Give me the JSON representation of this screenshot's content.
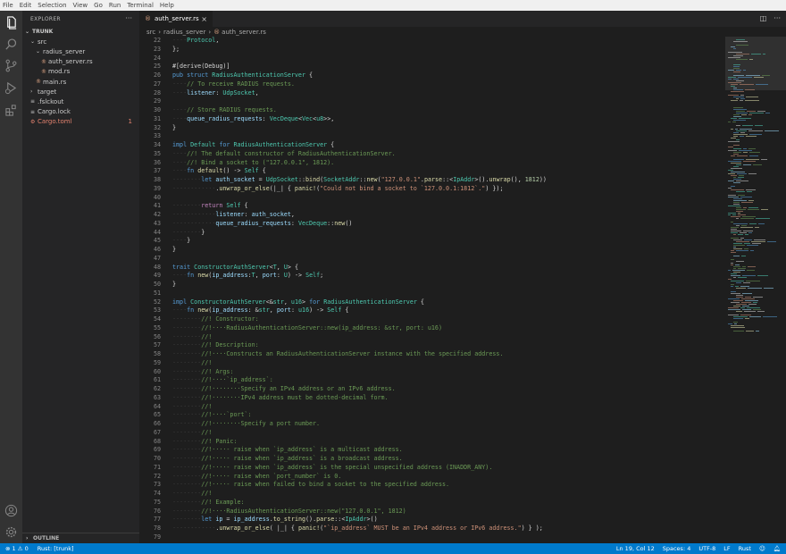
{
  "menu": [
    "File",
    "Edit",
    "Selection",
    "View",
    "Go",
    "Run",
    "Terminal",
    "Help"
  ],
  "activity_bar": [
    "files-icon",
    "search-icon",
    "source-control-icon",
    "run-debug-icon",
    "extensions-icon",
    "account-icon",
    "settings-gear-icon"
  ],
  "sidebar": {
    "title": "EXPLORER",
    "more": "···",
    "root": "TRUNK",
    "items": [
      {
        "label": "src",
        "depth": 1,
        "kind": "folder-open"
      },
      {
        "label": "radius_server",
        "depth": 2,
        "kind": "folder-open"
      },
      {
        "label": "auth_server.rs",
        "depth": 3,
        "kind": "rust"
      },
      {
        "label": "mod.rs",
        "depth": 3,
        "kind": "rust"
      },
      {
        "label": "main.rs",
        "depth": 2,
        "kind": "rust"
      },
      {
        "label": "target",
        "depth": 1,
        "kind": "folder"
      },
      {
        "label": ".fslckout",
        "depth": 1,
        "kind": "file"
      },
      {
        "label": "Cargo.lock",
        "depth": 1,
        "kind": "file"
      },
      {
        "label": "Cargo.toml",
        "depth": 1,
        "kind": "toml",
        "badge": "1"
      }
    ],
    "outline": "OUTLINE"
  },
  "tab": {
    "label": "auth_server.rs",
    "close": "×"
  },
  "breadcrumb": [
    "src",
    "radius_server",
    "auth_server.rs"
  ],
  "code_lines": [
    {
      "n": "22",
      "t": [
        [
          "ws",
          "····"
        ],
        [
          "ty",
          "Protocol"
        ],
        [
          "pl",
          ","
        ]
      ]
    },
    {
      "n": "23",
      "t": [
        [
          "pl",
          "};"
        ]
      ]
    },
    {
      "n": "24",
      "t": []
    },
    {
      "n": "25",
      "t": [
        [
          "at",
          "#[derive(Debug)]"
        ]
      ]
    },
    {
      "n": "26",
      "t": [
        [
          "kw",
          "pub struct "
        ],
        [
          "ty",
          "RadiusAuthenticationServer"
        ],
        [
          "pl",
          " {"
        ]
      ]
    },
    {
      "n": "27",
      "t": [
        [
          "ws",
          "····"
        ],
        [
          "cm",
          "// To receive RADIUS requests."
        ]
      ]
    },
    {
      "n": "28",
      "t": [
        [
          "ws",
          "····"
        ],
        [
          "var",
          "listener"
        ],
        [
          "pl",
          ": "
        ],
        [
          "ty",
          "UdpSocket"
        ],
        [
          "pl",
          ","
        ]
      ]
    },
    {
      "n": "29",
      "t": []
    },
    {
      "n": "30",
      "t": [
        [
          "ws",
          "····"
        ],
        [
          "cm",
          "// Store RADIUS requests."
        ]
      ]
    },
    {
      "n": "31",
      "t": [
        [
          "ws",
          "····"
        ],
        [
          "var",
          "queue_radius_requests"
        ],
        [
          "pl",
          ": "
        ],
        [
          "ty",
          "VecDeque"
        ],
        [
          "pl",
          "<"
        ],
        [
          "ty",
          "Vec"
        ],
        [
          "pl",
          "<"
        ],
        [
          "ty",
          "u8"
        ],
        [
          "pl",
          ">>,"
        ]
      ]
    },
    {
      "n": "32",
      "t": [
        [
          "pl",
          "}"
        ]
      ]
    },
    {
      "n": "33",
      "t": []
    },
    {
      "n": "34",
      "t": [
        [
          "kw",
          "impl "
        ],
        [
          "ty",
          "Default"
        ],
        [
          "kw",
          " for "
        ],
        [
          "ty",
          "RadiusAuthenticationServer"
        ],
        [
          "pl",
          " {"
        ]
      ]
    },
    {
      "n": "35",
      "t": [
        [
          "ws",
          "····"
        ],
        [
          "cm",
          "//! The default constructor of RadiusAuthenticationServer."
        ]
      ]
    },
    {
      "n": "36",
      "t": [
        [
          "ws",
          "····"
        ],
        [
          "cm",
          "//! Bind a socket to (\"127.0.0.1\", 1812)."
        ]
      ]
    },
    {
      "n": "37",
      "t": [
        [
          "ws",
          "····"
        ],
        [
          "kw",
          "fn "
        ],
        [
          "fn",
          "default"
        ],
        [
          "pl",
          "() -> "
        ],
        [
          "ty",
          "Self"
        ],
        [
          "pl",
          " {"
        ]
      ]
    },
    {
      "n": "38",
      "t": [
        [
          "ws",
          "········"
        ],
        [
          "kw",
          "let "
        ],
        [
          "var",
          "auth_socket"
        ],
        [
          "pl",
          " = "
        ],
        [
          "ty",
          "UdpSocket"
        ],
        [
          "pl",
          "::"
        ],
        [
          "fn",
          "bind"
        ],
        [
          "pl",
          "("
        ],
        [
          "ty",
          "SocketAddr"
        ],
        [
          "pl",
          "::"
        ],
        [
          "fn",
          "new"
        ],
        [
          "pl",
          "("
        ],
        [
          "str",
          "\"127.0.0.1\""
        ],
        [
          "pl",
          "."
        ],
        [
          "fn",
          "parse"
        ],
        [
          "pl",
          "::<"
        ],
        [
          "ty",
          "IpAddr"
        ],
        [
          "pl",
          ">()."
        ],
        [
          "fn",
          "unwrap"
        ],
        [
          "pl",
          "(), "
        ],
        [
          "num",
          "1812"
        ],
        [
          "pl",
          "))"
        ]
      ]
    },
    {
      "n": "39",
      "t": [
        [
          "ws",
          "············"
        ],
        [
          "pl",
          "."
        ],
        [
          "fn",
          "unwrap_or_else"
        ],
        [
          "pl",
          "(|_| { "
        ],
        [
          "fn",
          "panic!"
        ],
        [
          "pl",
          "("
        ],
        [
          "str",
          "\"Could not bind a socket to `127.0.0.1:1812`.\""
        ],
        [
          "pl",
          ") });"
        ]
      ]
    },
    {
      "n": "40",
      "t": []
    },
    {
      "n": "41",
      "t": [
        [
          "ws",
          "········"
        ],
        [
          "kw2",
          "return "
        ],
        [
          "ty",
          "Self"
        ],
        [
          "pl",
          " {"
        ]
      ]
    },
    {
      "n": "42",
      "t": [
        [
          "ws",
          "············"
        ],
        [
          "var",
          "listener"
        ],
        [
          "pl",
          ": "
        ],
        [
          "var",
          "auth_socket"
        ],
        [
          "pl",
          ","
        ]
      ]
    },
    {
      "n": "43",
      "t": [
        [
          "ws",
          "············"
        ],
        [
          "var",
          "queue_radius_requests"
        ],
        [
          "pl",
          ": "
        ],
        [
          "ty",
          "VecDeque"
        ],
        [
          "pl",
          "::"
        ],
        [
          "fn",
          "new"
        ],
        [
          "pl",
          "()"
        ]
      ]
    },
    {
      "n": "44",
      "t": [
        [
          "ws",
          "········"
        ],
        [
          "pl",
          "}"
        ]
      ]
    },
    {
      "n": "45",
      "t": [
        [
          "ws",
          "····"
        ],
        [
          "pl",
          "}"
        ]
      ]
    },
    {
      "n": "46",
      "t": [
        [
          "pl",
          "}"
        ]
      ]
    },
    {
      "n": "47",
      "t": []
    },
    {
      "n": "48",
      "t": [
        [
          "kw",
          "trait "
        ],
        [
          "ty",
          "ConstructorAuthServer"
        ],
        [
          "pl",
          "<"
        ],
        [
          "ty",
          "T"
        ],
        [
          "pl",
          ", "
        ],
        [
          "ty",
          "U"
        ],
        [
          "pl",
          "> {"
        ]
      ]
    },
    {
      "n": "49",
      "t": [
        [
          "ws",
          "····"
        ],
        [
          "kw",
          "fn "
        ],
        [
          "fn",
          "new"
        ],
        [
          "pl",
          "("
        ],
        [
          "var",
          "ip_address"
        ],
        [
          "pl",
          ":"
        ],
        [
          "ty",
          "T"
        ],
        [
          "pl",
          ", "
        ],
        [
          "var",
          "port"
        ],
        [
          "pl",
          ": "
        ],
        [
          "ty",
          "U"
        ],
        [
          "pl",
          ") -> "
        ],
        [
          "ty",
          "Self"
        ],
        [
          "pl",
          ";"
        ]
      ]
    },
    {
      "n": "50",
      "t": [
        [
          "pl",
          "}"
        ]
      ]
    },
    {
      "n": "51",
      "t": []
    },
    {
      "n": "52",
      "t": [
        [
          "kw",
          "impl "
        ],
        [
          "ty",
          "ConstructorAuthServer"
        ],
        [
          "pl",
          "<&"
        ],
        [
          "ty",
          "str"
        ],
        [
          "pl",
          ", "
        ],
        [
          "ty",
          "u16"
        ],
        [
          "pl",
          "> "
        ],
        [
          "kw",
          "for "
        ],
        [
          "ty",
          "RadiusAuthenticationServer"
        ],
        [
          "pl",
          " {"
        ]
      ]
    },
    {
      "n": "53",
      "t": [
        [
          "ws",
          "····"
        ],
        [
          "kw",
          "fn "
        ],
        [
          "fn",
          "new"
        ],
        [
          "pl",
          "("
        ],
        [
          "var",
          "ip_address"
        ],
        [
          "pl",
          ": &"
        ],
        [
          "ty",
          "str"
        ],
        [
          "pl",
          ", "
        ],
        [
          "var",
          "port"
        ],
        [
          "pl",
          ": "
        ],
        [
          "ty",
          "u16"
        ],
        [
          "pl",
          ") -> "
        ],
        [
          "ty",
          "Self"
        ],
        [
          "pl",
          " {"
        ]
      ]
    },
    {
      "n": "54",
      "t": [
        [
          "ws",
          "········"
        ],
        [
          "cm",
          "//! Constructor:"
        ]
      ]
    },
    {
      "n": "55",
      "t": [
        [
          "ws",
          "········"
        ],
        [
          "cm",
          "//!····RadiusAuthenticationServer::new(ip_address: &str, port: u16)"
        ]
      ]
    },
    {
      "n": "56",
      "t": [
        [
          "ws",
          "········"
        ],
        [
          "cm",
          "//!"
        ]
      ]
    },
    {
      "n": "57",
      "t": [
        [
          "ws",
          "········"
        ],
        [
          "cm",
          "//! Description:"
        ]
      ]
    },
    {
      "n": "58",
      "t": [
        [
          "ws",
          "········"
        ],
        [
          "cm",
          "//!····Constructs an RadiusAuthenticationServer instance with the specified address."
        ]
      ]
    },
    {
      "n": "59",
      "t": [
        [
          "ws",
          "········"
        ],
        [
          "cm",
          "//!"
        ]
      ]
    },
    {
      "n": "60",
      "t": [
        [
          "ws",
          "········"
        ],
        [
          "cm",
          "//! Args:"
        ]
      ]
    },
    {
      "n": "61",
      "t": [
        [
          "ws",
          "········"
        ],
        [
          "cm",
          "//!····`ip_address`:"
        ]
      ]
    },
    {
      "n": "62",
      "t": [
        [
          "ws",
          "········"
        ],
        [
          "cm",
          "//!········Specify an IPv4 address or an IPv6 address."
        ]
      ]
    },
    {
      "n": "63",
      "t": [
        [
          "ws",
          "········"
        ],
        [
          "cm",
          "//!········IPv4 address must be dotted-decimal form."
        ]
      ]
    },
    {
      "n": "64",
      "t": [
        [
          "ws",
          "········"
        ],
        [
          "cm",
          "//!"
        ]
      ]
    },
    {
      "n": "65",
      "t": [
        [
          "ws",
          "········"
        ],
        [
          "cm",
          "//!····`port`:"
        ]
      ]
    },
    {
      "n": "66",
      "t": [
        [
          "ws",
          "········"
        ],
        [
          "cm",
          "//!········Specify a port number."
        ]
      ]
    },
    {
      "n": "67",
      "t": [
        [
          "ws",
          "········"
        ],
        [
          "cm",
          "//!"
        ]
      ]
    },
    {
      "n": "68",
      "t": [
        [
          "ws",
          "········"
        ],
        [
          "cm",
          "//! Panic:"
        ]
      ]
    },
    {
      "n": "69",
      "t": [
        [
          "ws",
          "········"
        ],
        [
          "cm",
          "//!····- raise when `ip_address` is a multicast address."
        ]
      ]
    },
    {
      "n": "70",
      "t": [
        [
          "ws",
          "········"
        ],
        [
          "cm",
          "//!····- raise when `ip_address` is a broadcast address."
        ]
      ]
    },
    {
      "n": "71",
      "t": [
        [
          "ws",
          "········"
        ],
        [
          "cm",
          "//!····- raise when `ip_address` is the special unspecified address (INADDR_ANY)."
        ]
      ]
    },
    {
      "n": "72",
      "t": [
        [
          "ws",
          "········"
        ],
        [
          "cm",
          "//!····- raise when `port_number` is 0."
        ]
      ]
    },
    {
      "n": "73",
      "t": [
        [
          "ws",
          "········"
        ],
        [
          "cm",
          "//!····- raise when failed to bind a socket to the specified address."
        ]
      ]
    },
    {
      "n": "74",
      "t": [
        [
          "ws",
          "········"
        ],
        [
          "cm",
          "//!"
        ]
      ]
    },
    {
      "n": "75",
      "t": [
        [
          "ws",
          "········"
        ],
        [
          "cm",
          "//! Example:"
        ]
      ]
    },
    {
      "n": "76",
      "t": [
        [
          "ws",
          "········"
        ],
        [
          "cm",
          "//!····RadiusAuthenticationServer::new(\"127.0.0.1\", 1812)"
        ]
      ]
    },
    {
      "n": "77",
      "t": [
        [
          "ws",
          "········"
        ],
        [
          "kw",
          "let "
        ],
        [
          "var",
          "ip"
        ],
        [
          "pl",
          " = "
        ],
        [
          "var",
          "ip_address"
        ],
        [
          "pl",
          "."
        ],
        [
          "fn",
          "to_string"
        ],
        [
          "pl",
          "()."
        ],
        [
          "fn",
          "parse"
        ],
        [
          "pl",
          "::<"
        ],
        [
          "ty",
          "IpAddr"
        ],
        [
          "pl",
          ">()"
        ]
      ]
    },
    {
      "n": "78",
      "t": [
        [
          "ws",
          "············"
        ],
        [
          "pl",
          "."
        ],
        [
          "fn",
          "unwrap_or_else"
        ],
        [
          "pl",
          "( |_| { "
        ],
        [
          "fn",
          "panic!"
        ],
        [
          "pl",
          "("
        ],
        [
          "str",
          "\"`ip_address` MUST be an IPv4 address or IPv6 address.\""
        ],
        [
          "pl",
          ") } );"
        ]
      ]
    },
    {
      "n": "79",
      "t": []
    }
  ],
  "status": {
    "errors": "⊗ 1 ⚠ 0",
    "rust": "Rust: [trunk]",
    "position": "Ln 19, Col 12",
    "spaces": "Spaces: 4",
    "encoding": "UTF-8",
    "eol": "LF",
    "language": "Rust"
  },
  "colors": {
    "accent": "#007acc",
    "activity_bar": "#333333",
    "sidebar": "#252526",
    "editor": "#1e1e1e",
    "error": "#e2826e"
  }
}
